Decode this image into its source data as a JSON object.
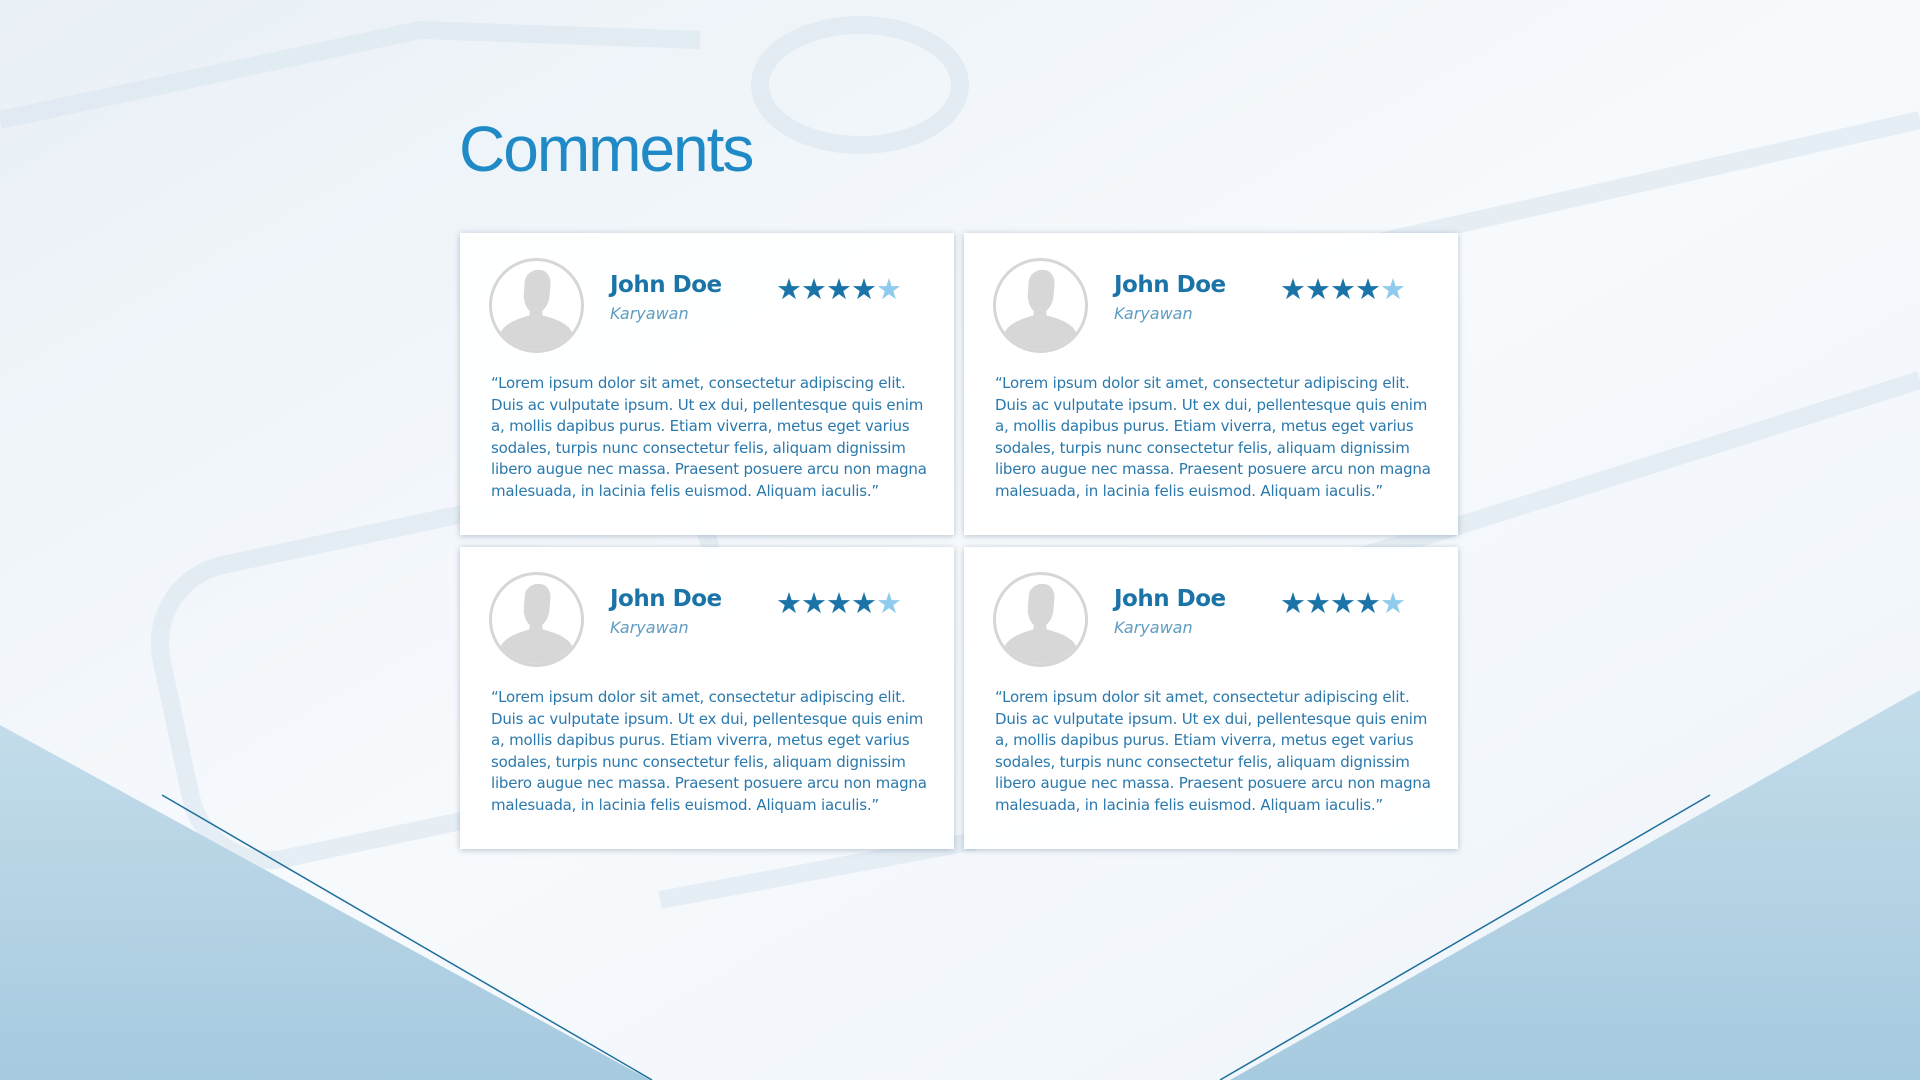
{
  "page": {
    "title": "Comments"
  },
  "theme": {
    "accent": "#1f8ac5",
    "name_color": "#1a74a8",
    "text_color": "#2a79ad",
    "star_filled": "#1a74a8",
    "star_light": "#8fcbec",
    "bottom_band": "#a9cde2",
    "line_color": "#1c6f9c"
  },
  "comments": [
    {
      "name": "John Doe",
      "role": "Karyawan",
      "rating": 4.5,
      "avatar_icon": "user-silhouette-icon",
      "text": "“Lorem ipsum dolor sit amet, consectetur adipiscing elit. Duis ac vulputate ipsum. Ut ex dui, pellentesque quis enim a, mollis dapibus purus. Etiam viverra, metus eget varius sodales, turpis nunc consectetur felis, aliquam dignissim libero augue nec massa. Praesent posuere arcu non magna malesuada, in lacinia felis euismod. Aliquam iaculis.”"
    },
    {
      "name": "John Doe",
      "role": "Karyawan",
      "rating": 4.5,
      "avatar_icon": "user-silhouette-icon",
      "text": "“Lorem ipsum dolor sit amet, consectetur adipiscing elit. Duis ac vulputate ipsum. Ut ex dui, pellentesque quis enim a, mollis dapibus purus. Etiam viverra, metus eget varius sodales, turpis nunc consectetur felis, aliquam dignissim libero augue nec massa. Praesent posuere arcu non magna malesuada, in lacinia felis euismod. Aliquam iaculis.”"
    },
    {
      "name": "John Doe",
      "role": "Karyawan",
      "rating": 4.5,
      "avatar_icon": "user-silhouette-icon",
      "text": "“Lorem ipsum dolor sit amet, consectetur adipiscing elit. Duis ac vulputate ipsum. Ut ex dui, pellentesque quis enim a, mollis dapibus purus. Etiam viverra, metus eget varius sodales, turpis nunc consectetur felis, aliquam dignissim libero augue nec massa. Praesent posuere arcu non magna malesuada, in lacinia felis euismod. Aliquam iaculis.”"
    },
    {
      "name": "John Doe",
      "role": "Karyawan",
      "rating": 4.5,
      "avatar_icon": "user-silhouette-icon",
      "text": "“Lorem ipsum dolor sit amet, consectetur adipiscing elit. Duis ac vulputate ipsum. Ut ex dui, pellentesque quis enim a, mollis dapibus purus. Etiam viverra, metus eget varius sodales, turpis nunc consectetur felis, aliquam dignissim libero augue nec massa. Praesent posuere arcu non magna malesuada, in lacinia felis euismod. Aliquam iaculis.”"
    }
  ]
}
